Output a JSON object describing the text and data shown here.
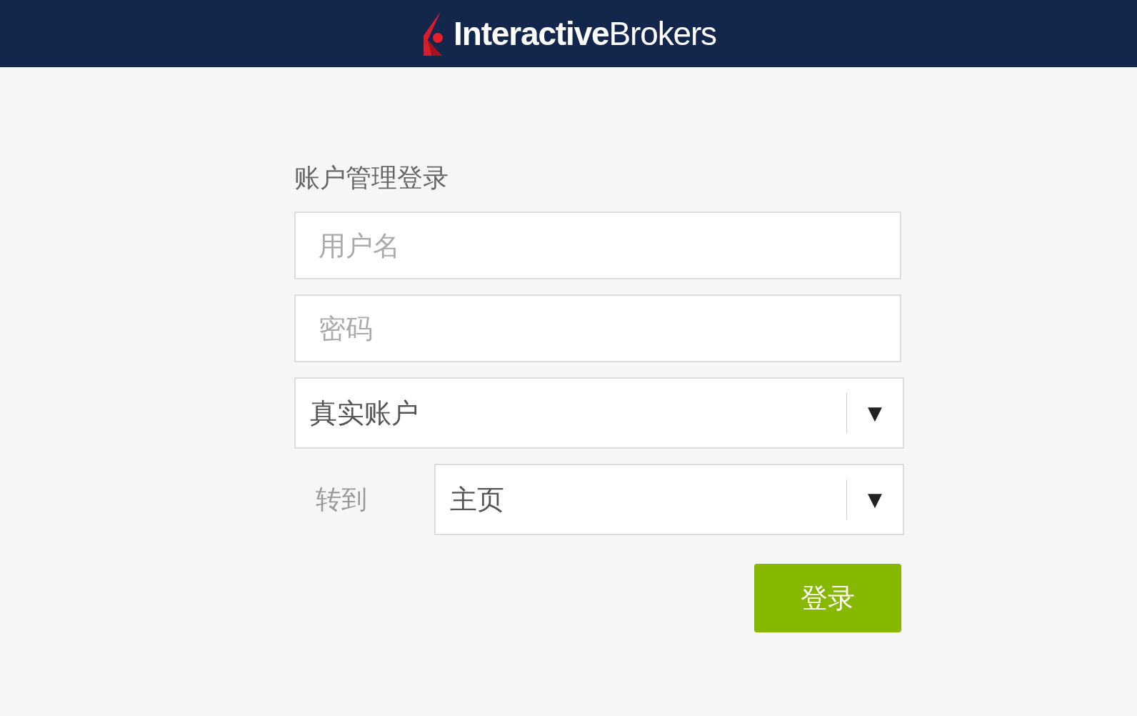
{
  "header": {
    "logo_text": "**Interactive**Brokers"
  },
  "form": {
    "title": "账户管理登录",
    "username": {
      "placeholder": "用户名"
    },
    "password": {
      "placeholder": "密码"
    },
    "account_type": {
      "value": "真实账户",
      "arrow": "▼"
    },
    "goto": {
      "label": "转到",
      "value": "主页",
      "arrow": "▼"
    },
    "submit": "登录"
  }
}
